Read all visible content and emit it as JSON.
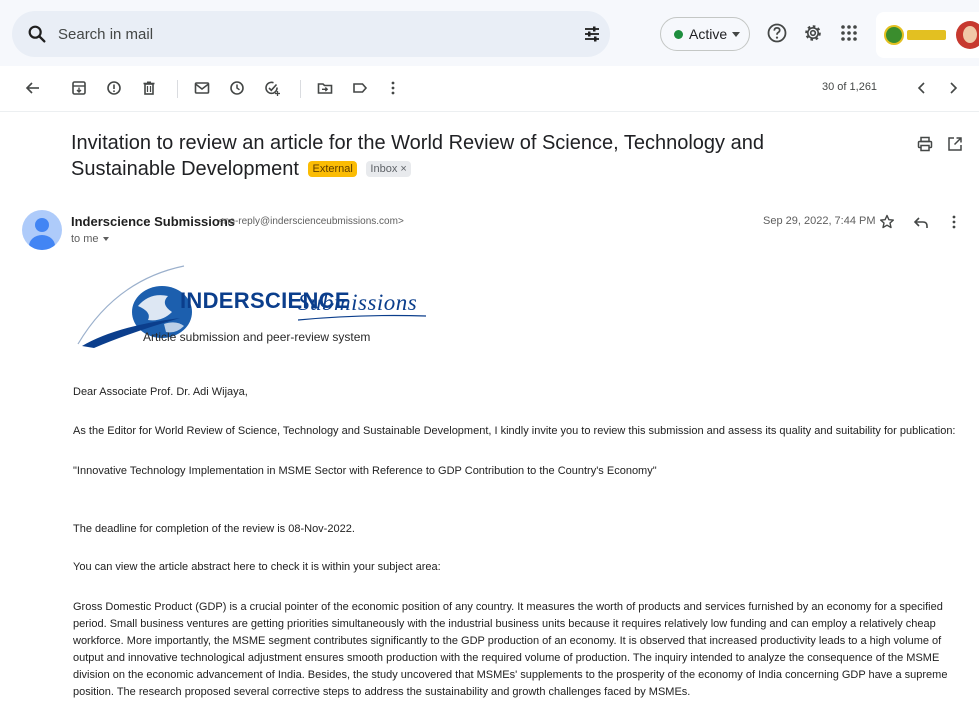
{
  "search": {
    "placeholder": "Search in mail"
  },
  "status": {
    "label": "Active",
    "color": "#1e8e3e"
  },
  "header_icons": [
    "search-icon",
    "filter-options-icon",
    "help-icon",
    "settings-icon",
    "apps-grid-icon"
  ],
  "toolbar": {
    "icons": [
      "back-arrow-icon",
      "archive-icon",
      "report-spam-icon",
      "delete-icon",
      "mark-unread-icon",
      "snooze-icon",
      "add-to-tasks-icon",
      "move-to-icon",
      "label-icon",
      "more-vert-icon"
    ],
    "pager": "30 of 1,261"
  },
  "message": {
    "subject": "Invitation to review an article for the World Review of Science, Technology and Sustainable Development",
    "labels": {
      "external": "External",
      "inbox": "Inbox",
      "inbox_remove": "×"
    },
    "sender_name": "Inderscience Submissions",
    "sender_email": "<no-reply@inderscienceubmissions.com>",
    "recipient": "to me",
    "date": "Sep 29, 2022, 7:44 PM"
  },
  "logo": {
    "brand": "INDERSCIENCE",
    "brand_suffix": "Submissions",
    "tagline": "Article submission and peer-review system"
  },
  "body": {
    "greeting": "Dear Associate Prof. Dr. Adi Wijaya,",
    "p1": "As the Editor for World Review of Science, Technology and Sustainable Development, I kindly invite you to review this submission and assess its quality and suitability for publication:",
    "title_quote": "\"Innovative Technology Implementation in MSME Sector with Reference to GDP Contribution to the Country's Economy\"",
    "deadline": "The deadline for completion of the review is 08-Nov-2022.",
    "abstract_intro": "You can view the article abstract here to check it is within your subject area:",
    "abstract": "Gross Domestic Product (GDP) is a crucial pointer of the economic position of any country. It measures the worth of products and services furnished by an economy for a specified period. Small business ventures are getting priorities simultaneously with the industrial business units because it requires relatively low funding and can employ a relatively cheap workforce. More importantly, the MSME segment contributes significantly to the GDP production of an economy. It is observed that increased productivity leads to a high volume of output and innovative technological adjustment ensures smooth production with the required volume of production. The inquiry intended to analyze the consequence of the MSME division on the economic advancement of India. Besides, the study uncovered that MSMEs' supplements to the prosperity of the economy of India concerning GDP have a supreme position. The research proposed several corrective steps to address the sustainability and growth challenges faced by MSMEs."
  }
}
